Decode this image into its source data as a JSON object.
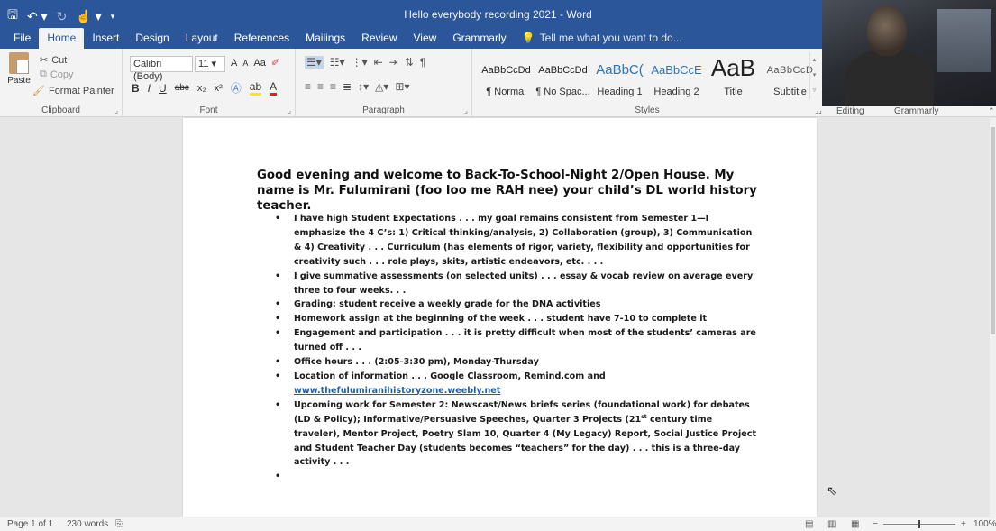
{
  "window": {
    "title": "Hello everybody recording 2021 - Word"
  },
  "qat": {
    "save_icon": "save-icon",
    "undo_icon": "undo-icon",
    "redo_icon": "redo-icon",
    "touch_icon": "touch-mode-icon"
  },
  "tabs": [
    {
      "label": "File"
    },
    {
      "label": "Home"
    },
    {
      "label": "Insert"
    },
    {
      "label": "Design"
    },
    {
      "label": "Layout"
    },
    {
      "label": "References"
    },
    {
      "label": "Mailings"
    },
    {
      "label": "Review"
    },
    {
      "label": "View"
    },
    {
      "label": "Grammarly"
    }
  ],
  "tell_me": "Tell me what you want to do...",
  "clipboard": {
    "paste": "Paste",
    "cut": "Cut",
    "copy": "Copy",
    "format_painter": "Format Painter",
    "group": "Clipboard"
  },
  "font": {
    "name": "Calibri (Body)",
    "size": "11",
    "group": "Font",
    "grow": "A",
    "shrink": "A",
    "case": "Aa"
  },
  "paragraph": {
    "group": "Paragraph"
  },
  "styles": {
    "group": "Styles",
    "items": [
      {
        "sample": "AaBbCcDd",
        "name": "¶ Normal"
      },
      {
        "sample": "AaBbCcDd",
        "name": "¶ No Spac..."
      },
      {
        "sample": "AaBbC(",
        "name": "Heading 1"
      },
      {
        "sample": "AaBbCcE",
        "name": "Heading 2"
      },
      {
        "sample": "AaB",
        "name": "Title"
      },
      {
        "sample": "AaBbCcD",
        "name": "Subtitle"
      }
    ]
  },
  "ribbon_right": {
    "editing": "Editing",
    "grammarly": "Grammarly"
  },
  "document": {
    "heading": "Good evening and welcome to Back-To-School-Night 2/Open House. My name is Mr. Fulumirani (foo loo me RAH nee) your child’s DL world history teacher.",
    "bullets": [
      "I have high Student Expectations . . . my goal remains consistent from Semester 1—I emphasize the 4 C’s: 1) Critical thinking/analysis, 2) Collaboration (group), 3) Communication & 4) Creativity . . .  Curriculum (has elements of rigor, variety, flexibility and opportunities for creativity such . . . role plays, skits, artistic endeavors, etc. . . .",
      "I give summative assessments (on selected units) . . . essay & vocab review on average every three to four weeks. . .",
      "Grading: student receive a weekly grade for the DNA activities",
      "Homework assign at the beginning of the week . . . student have 7-10 to complete it",
      "Engagement and participation  . . . it is pretty difficult when most of the students’ cameras are turned off . . .",
      "Office hours . . . (2:05-3:30 pm), Monday-Thursday",
      "Location of information . . . Google Classroom, Remind.com and",
      "Upcoming work for Semester 2: Newscast/News briefs series (foundational work) for debates (LD & Policy); Informative/Persuasive Speeches, Quarter 3 Projects (21",
      ""
    ],
    "link": "www.thefulumiranihistoryzone.weebly.net",
    "bullet8_sup": "st",
    "bullet8_rest": " century time traveler), Mentor Project, Poetry Slam 10, Quarter 4 (My Legacy) Report, Social Justice Project and Student Teacher Day (students becomes “teachers” for the day) . . . this is a three-day activity . . ."
  },
  "status": {
    "page": "Page 1 of 1",
    "words": "230 words",
    "zoom": "100%"
  }
}
